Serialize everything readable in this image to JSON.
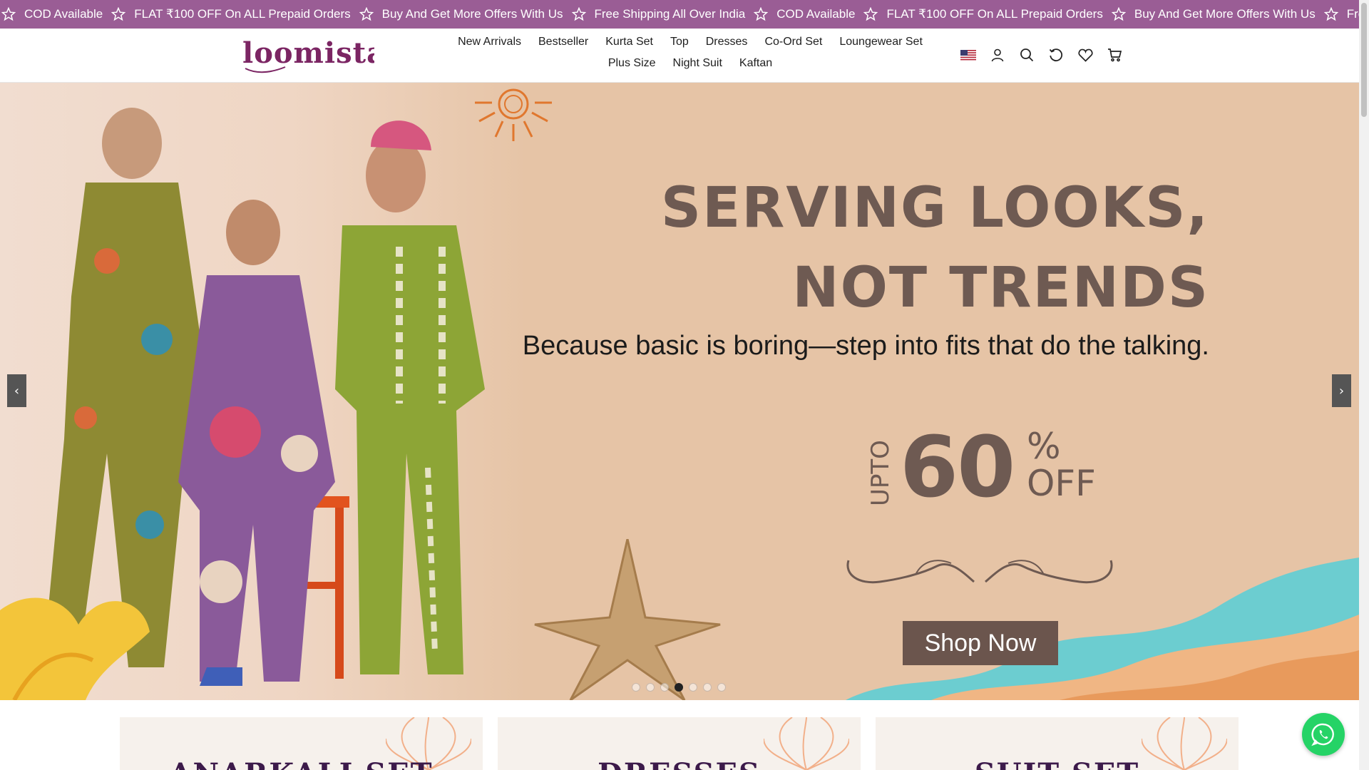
{
  "announcement": {
    "items": [
      "COD Available",
      "FLAT ₹100 OFF On ALL Prepaid Orders",
      "Buy And Get More Offers With Us",
      "Free Shipping All Over India",
      "COD Available",
      "FLAT ₹100 OFF On ALL Prepaid Orders",
      "Buy And Get More Offers With Us",
      "Free Shipping All Over India"
    ],
    "icon": "star-icon",
    "background": "#9a5d95"
  },
  "header": {
    "logo_text": "loomista",
    "nav": [
      "New Arrivals",
      "Bestseller",
      "Kurta Set",
      "Top",
      "Dresses",
      "Co-Ord Set",
      "Loungewear Set",
      "Plus Size",
      "Night Suit",
      "Kaftan"
    ],
    "icons": [
      "us-flag-icon",
      "account-icon",
      "search-icon",
      "recently-viewed-icon",
      "wishlist-heart-icon",
      "cart-icon"
    ]
  },
  "hero": {
    "title_line1": "SERVING LOOKS,",
    "title_line2": "NOT TRENDS",
    "subtitle": "Because basic is boring—step into fits that do the talking.",
    "offer_prefix": "UPTO",
    "offer_value": "60",
    "offer_percent": "%",
    "offer_suffix": "OFF",
    "cta": "Shop Now",
    "prev_arrow": "‹",
    "next_arrow": "›",
    "slides_total": 7,
    "active_slide": 4,
    "colors": {
      "text": "#6e5a52",
      "button": "#6b554d",
      "background": "#e6c4a6"
    }
  },
  "collections": [
    {
      "label": "ANARKALI SET"
    },
    {
      "label": "DRESSES"
    },
    {
      "label": "SUIT SET"
    }
  ],
  "whatsapp": {
    "icon": "whatsapp-icon",
    "color": "#25d366"
  }
}
